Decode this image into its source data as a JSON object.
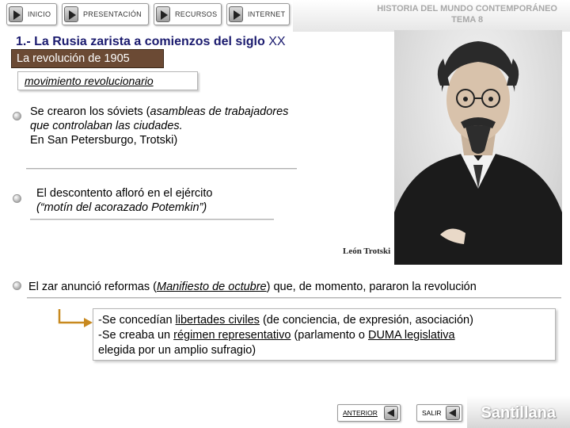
{
  "nav": {
    "inicio": "INICIO",
    "presentacion": "PRESENTACIÓN",
    "recursos": "RECURSOS",
    "internet": "INTERNET"
  },
  "header": {
    "line1": "HISTORIA DEL MUNDO CONTEMPORÁNEO",
    "line2": "TEMA 8"
  },
  "title": {
    "main": "1.- La Rusia zarista a comienzos del siglo",
    "suffix": " XX"
  },
  "section": "La revolución de 1905",
  "subsection": "movimiento revolucionario",
  "points": {
    "p1_line1": "Se crearon los sóviets (",
    "p1_italic": "asambleas de trabajadores que controlaban las ciudades.",
    "p1_line3": "En San Petersburgo, Trotski)",
    "p2_line1": "El descontento afloró en el ejército",
    "p2_line2": "(“motín del acorazado Potemkin”)",
    "p3_a": "El zar anunció reformas (",
    "p3_link": "Manifiesto de octubre",
    "p3_b": ") que, de momento, pararon la revolución"
  },
  "caption": "León Trotski",
  "result": {
    "l1_a": "-Se concedían ",
    "l1_u": "libertades civiles",
    "l1_b": " (de conciencia, de expresión, asociación)",
    "l2_a": "-Se creaba un ",
    "l2_u1": "régimen representativo",
    "l2_b": " (parlamento o ",
    "l2_u2": "DUMA legislativa",
    "l3": "elegida por un amplio sufragio)"
  },
  "footer": {
    "anterior": "ANTERIOR",
    "salir": "SALIR",
    "brand": "Santillana"
  },
  "colors": {
    "title": "#1a1a6e",
    "badge": "#6b4a34",
    "header_text": "#a8a8a8"
  }
}
